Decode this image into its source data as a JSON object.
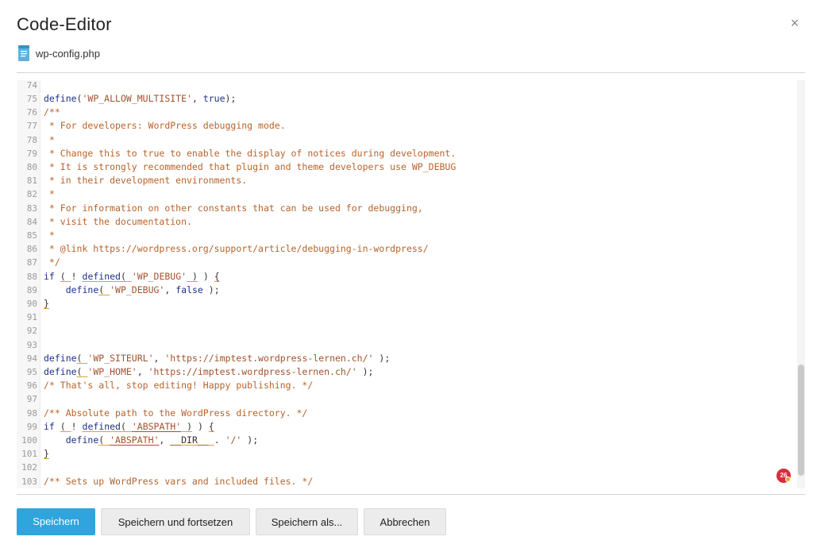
{
  "dialog": {
    "title": "Code-Editor",
    "close_label": "×",
    "file_name": "wp-config.php"
  },
  "notification_badge": "26",
  "buttons": {
    "save": "Speichern",
    "save_continue": "Speichern und fortsetzen",
    "save_as": "Speichern als...",
    "cancel": "Abbrechen"
  },
  "colors": {
    "primary": "#30a4dc",
    "badge": "#d92c3b"
  },
  "editor": {
    "partial_line_number": "74",
    "lines": [
      {
        "n": "75",
        "tokens": [
          [
            "fn",
            "define"
          ],
          [
            "",
            "("
          ],
          [
            "str",
            "'WP_ALLOW_MULTISITE'"
          ],
          [
            "",
            ", "
          ],
          [
            "kw",
            "true"
          ],
          [
            "",
            ");"
          ]
        ]
      },
      {
        "n": "76",
        "tokens": [
          [
            "cm",
            "/**"
          ]
        ]
      },
      {
        "n": "77",
        "tokens": [
          [
            "cm",
            " * For developers: WordPress debugging mode."
          ]
        ]
      },
      {
        "n": "78",
        "tokens": [
          [
            "cm",
            " *"
          ]
        ]
      },
      {
        "n": "79",
        "tokens": [
          [
            "cm",
            " * Change this to true to enable the display of notices during development."
          ]
        ]
      },
      {
        "n": "80",
        "tokens": [
          [
            "cm",
            " * It is strongly recommended that plugin and theme developers use WP_DEBUG"
          ]
        ]
      },
      {
        "n": "81",
        "tokens": [
          [
            "cm",
            " * in their development environments."
          ]
        ]
      },
      {
        "n": "82",
        "tokens": [
          [
            "cm",
            " *"
          ]
        ]
      },
      {
        "n": "83",
        "tokens": [
          [
            "cm",
            " * For information on other constants that can be used for debugging,"
          ]
        ]
      },
      {
        "n": "84",
        "tokens": [
          [
            "cm",
            " * visit the documentation."
          ]
        ]
      },
      {
        "n": "85",
        "tokens": [
          [
            "cm",
            " *"
          ]
        ]
      },
      {
        "n": "86",
        "tokens": [
          [
            "cm",
            " * @link https://wordpress.org/support/article/debugging-in-wordpress/"
          ]
        ]
      },
      {
        "n": "87",
        "tokens": [
          [
            "cm",
            " */"
          ]
        ]
      },
      {
        "n": "88",
        "tokens": [
          [
            "kw",
            "if"
          ],
          [
            "",
            " "
          ],
          [
            "ul",
            "( "
          ],
          [
            "",
            "! "
          ],
          [
            "fn ul",
            "defined"
          ],
          [
            "ul",
            "( "
          ],
          [
            "str",
            "'WP_DEBUG'"
          ],
          [
            "ul",
            " )"
          ],
          [
            "",
            " ) "
          ],
          [
            "ul",
            "{"
          ]
        ]
      },
      {
        "n": "89",
        "tokens": [
          [
            "",
            "    "
          ],
          [
            "fn",
            "define"
          ],
          [
            "ul",
            "( "
          ],
          [
            "str",
            "'WP_DEBUG'"
          ],
          [
            "",
            ", "
          ],
          [
            "kw",
            "false"
          ],
          [
            "",
            " );"
          ]
        ]
      },
      {
        "n": "90",
        "tokens": [
          [
            "ul",
            "}"
          ]
        ]
      },
      {
        "n": "91",
        "tokens": []
      },
      {
        "n": "92",
        "tokens": []
      },
      {
        "n": "93",
        "tokens": []
      },
      {
        "n": "94",
        "tokens": [
          [
            "fn",
            "define"
          ],
          [
            "ul",
            "( "
          ],
          [
            "str",
            "'WP_SITEURL'"
          ],
          [
            "",
            ", "
          ],
          [
            "str",
            "'https://imptest.wordpress-lernen.ch/'"
          ],
          [
            "",
            " );"
          ]
        ]
      },
      {
        "n": "95",
        "tokens": [
          [
            "fn",
            "define"
          ],
          [
            "ul",
            "( "
          ],
          [
            "str",
            "'WP_HOME'"
          ],
          [
            "",
            ", "
          ],
          [
            "str",
            "'https://imptest.wordpress-lernen.ch/'"
          ],
          [
            "",
            " );"
          ]
        ]
      },
      {
        "n": "96",
        "tokens": [
          [
            "cm",
            "/* That's all, stop editing! Happy publishing. */"
          ]
        ]
      },
      {
        "n": "97",
        "tokens": []
      },
      {
        "n": "98",
        "tokens": [
          [
            "cm",
            "/** Absolute path to the WordPress directory. */"
          ]
        ]
      },
      {
        "n": "99",
        "tokens": [
          [
            "kw",
            "if"
          ],
          [
            "",
            " "
          ],
          [
            "ul",
            "( "
          ],
          [
            "",
            "! "
          ],
          [
            "fn ul",
            "defined"
          ],
          [
            "ul",
            "( "
          ],
          [
            "str ur",
            "'ABSPATH'"
          ],
          [
            "ul",
            " )"
          ],
          [
            "",
            " ) "
          ],
          [
            "ul",
            "{"
          ]
        ]
      },
      {
        "n": "100",
        "tokens": [
          [
            "",
            "    "
          ],
          [
            "fn",
            "define"
          ],
          [
            "ul",
            "( "
          ],
          [
            "str ur",
            "'ABSPATH'"
          ],
          [
            "",
            ", "
          ],
          [
            "ul",
            "__DIR__"
          ],
          [
            "ul",
            " "
          ],
          [
            "",
            "."
          ],
          [
            "",
            " "
          ],
          [
            "str",
            "'/'"
          ],
          [
            "",
            " );"
          ]
        ]
      },
      {
        "n": "101",
        "tokens": [
          [
            "ul",
            "}"
          ]
        ]
      },
      {
        "n": "102",
        "tokens": []
      },
      {
        "n": "103",
        "tokens": [
          [
            "cm",
            "/** Sets up WordPress vars and included files. */"
          ]
        ]
      }
    ]
  }
}
